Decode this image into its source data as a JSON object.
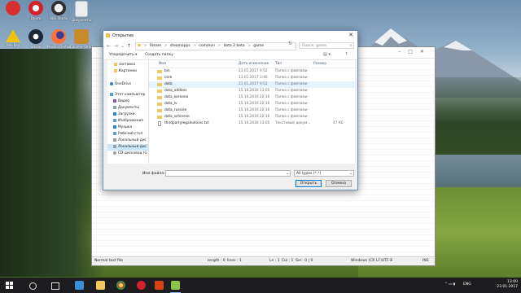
{
  "desktop": {
    "icons": [
      {
        "label": "",
        "color": "#d32f2f"
      },
      {
        "label": "Opera",
        "color": "#d2232a"
      },
      {
        "label": "OBS Studio",
        "color": "#302e31"
      },
      {
        "label": "Документы",
        "color": "#cfd8dc"
      },
      {
        "label": "Win Key",
        "color": "#f4c20d"
      },
      {
        "label": "Steam",
        "color": "#1b2838"
      },
      {
        "label": "Mozilla Firefox",
        "color": "#ff7139"
      },
      {
        "label": "Counter-Strike Global Off...",
        "color": "#c98a2b"
      }
    ]
  },
  "editor": {
    "status": {
      "mode": "Normal text file",
      "length": "length : 0",
      "lines": "lines : 1",
      "ln": "Ln : 1",
      "col": "Col : 1",
      "sel": "Sel : 0 | 0",
      "eol": "Windows (CR LF)",
      "encoding": "UTF-8",
      "ins": "INS"
    }
  },
  "dialog": {
    "title": "Открытие",
    "close_glyph": "✕",
    "nav": {
      "back": "←",
      "forward": "→",
      "up": "↑",
      "recent": "⌄"
    },
    "address": {
      "segments": [
        "Steam",
        "steamapps",
        "common",
        "dota 2 beta",
        "game"
      ],
      "separator": ">",
      "refresh": "↻"
    },
    "search": {
      "placeholder": "Поиск: game",
      "icon": "⌕"
    },
    "commands": {
      "organize": "Упорядочить ▾",
      "new_folder": "Создать папку",
      "view": "▤ ▾",
      "help": "?"
    },
    "sidebar": [
      {
        "label": "заставка",
        "icon_color": "#f2c75c",
        "selected": false
      },
      {
        "label": "Картинки",
        "icon_color": "#f2c75c",
        "selected": false
      },
      {
        "label": "",
        "icon_color": "",
        "selected": false
      },
      {
        "label": "OneDrive",
        "icon_color": "#2b7cd3",
        "selected": false
      },
      {
        "label": "",
        "icon_color": "",
        "selected": false
      },
      {
        "label": "Этот компьютер",
        "icon_color": "#5a9fd4",
        "selected": false
      },
      {
        "label": "Видео",
        "icon_color": "#7e57c2",
        "selected": false
      },
      {
        "label": "Документы",
        "icon_color": "#90a4ae",
        "selected": false
      },
      {
        "label": "Загрузки",
        "icon_color": "#1e88e5",
        "selected": false
      },
      {
        "label": "Изображения",
        "icon_color": "#5a9fd4",
        "selected": false
      },
      {
        "label": "Музыка",
        "icon_color": "#1e88e5",
        "selected": false
      },
      {
        "label": "Рабочий стол",
        "icon_color": "#5a9fd4",
        "selected": false
      },
      {
        "label": "Локальный дис",
        "icon_color": "#9e9e9e",
        "selected": false
      },
      {
        "label": "Локальный дис",
        "icon_color": "#9e9e9e",
        "selected": true
      },
      {
        "label": "CD-дисковод (G",
        "icon_color": "#9e9e9e",
        "selected": false
      }
    ],
    "columns": {
      "name": "Имя",
      "date": "Дата изменения",
      "type": "Тип",
      "size": "Размер"
    },
    "files": [
      {
        "name": "bin",
        "date": "23.01.2017 9:52",
        "type": "Папка с файлами",
        "size": "",
        "kind": "folder"
      },
      {
        "name": "core",
        "date": "13.01.2017 3:46",
        "type": "Папка с файлами",
        "size": "",
        "kind": "folder"
      },
      {
        "name": "dota",
        "date": "21.01.2017 9:52",
        "type": "Папка с файлами",
        "size": "",
        "kind": "folder"
      },
      {
        "name": "dota_addons",
        "date": "15.10.2016 13:05",
        "type": "Папка с файлами",
        "size": "",
        "kind": "folder"
      },
      {
        "name": "dota_koreana",
        "date": "15.10.2016 22:16",
        "type": "Папка с файлами",
        "size": "",
        "kind": "folder"
      },
      {
        "name": "dota_lv",
        "date": "15.10.2016 22:16",
        "type": "Папка с файлами",
        "size": "",
        "kind": "folder"
      },
      {
        "name": "dota_russian",
        "date": "15.10.2016 22:16",
        "type": "Папка с файлами",
        "size": "",
        "kind": "folder"
      },
      {
        "name": "dota_schinese",
        "date": "15.10.2016 22:16",
        "type": "Папка с файлами",
        "size": "",
        "kind": "folder"
      },
      {
        "name": "thirdpartylegalnotices.txt",
        "date": "15.10.2016 13:05",
        "type": "Текстовый докум...",
        "size": "47 КБ",
        "kind": "file"
      }
    ],
    "hover_row": 2,
    "filename_label": "Имя файла:",
    "filename_value": "",
    "filetype": "All types (*.*)",
    "open_label": "Открыть",
    "cancel_label": "Отмена"
  },
  "taskbar": {
    "lang": "ENG",
    "time": "13:00",
    "date": "23.01.2017",
    "tray_icons": "⌃  ▭  ◗"
  }
}
